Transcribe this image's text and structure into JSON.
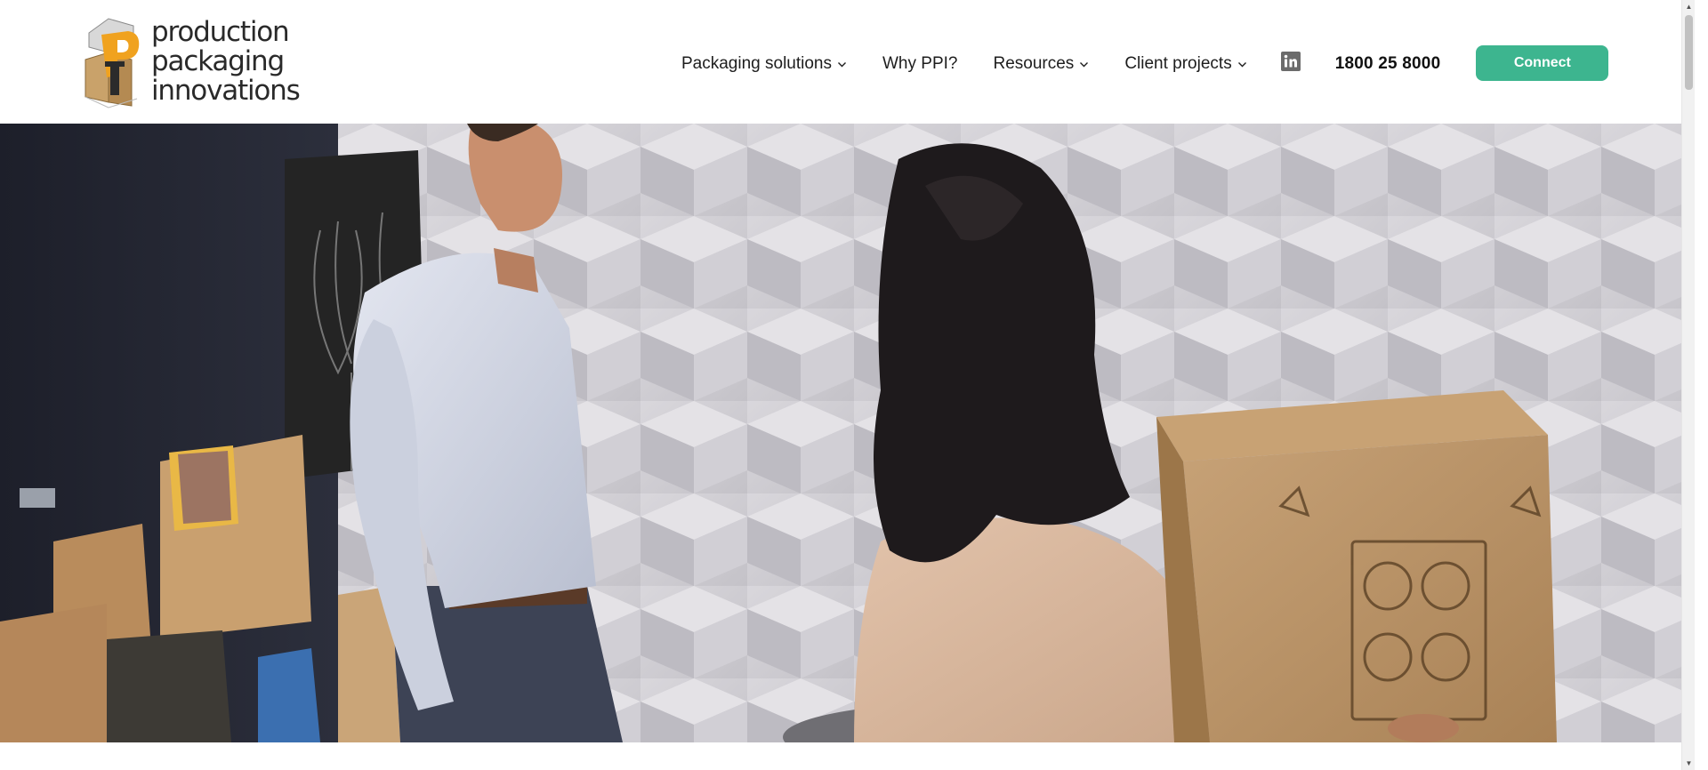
{
  "header": {
    "logo": {
      "line1": "production",
      "line2": "packaging",
      "line3": "innovations"
    },
    "nav": {
      "solutions": "Packaging solutions",
      "why": "Why PPI?",
      "resources": "Resources",
      "clients": "Client projects"
    },
    "linkedin_icon": "linkedin-icon",
    "phone": "1800 25 8000",
    "connect_label": "Connect"
  },
  "colors": {
    "accent": "#3db58f",
    "logo_orange": "#f0a21f",
    "text_dark": "#1d1d1d",
    "icon_gray": "#6b6b6b"
  },
  "hero": {
    "image": "people-carrying-packaging-box"
  }
}
